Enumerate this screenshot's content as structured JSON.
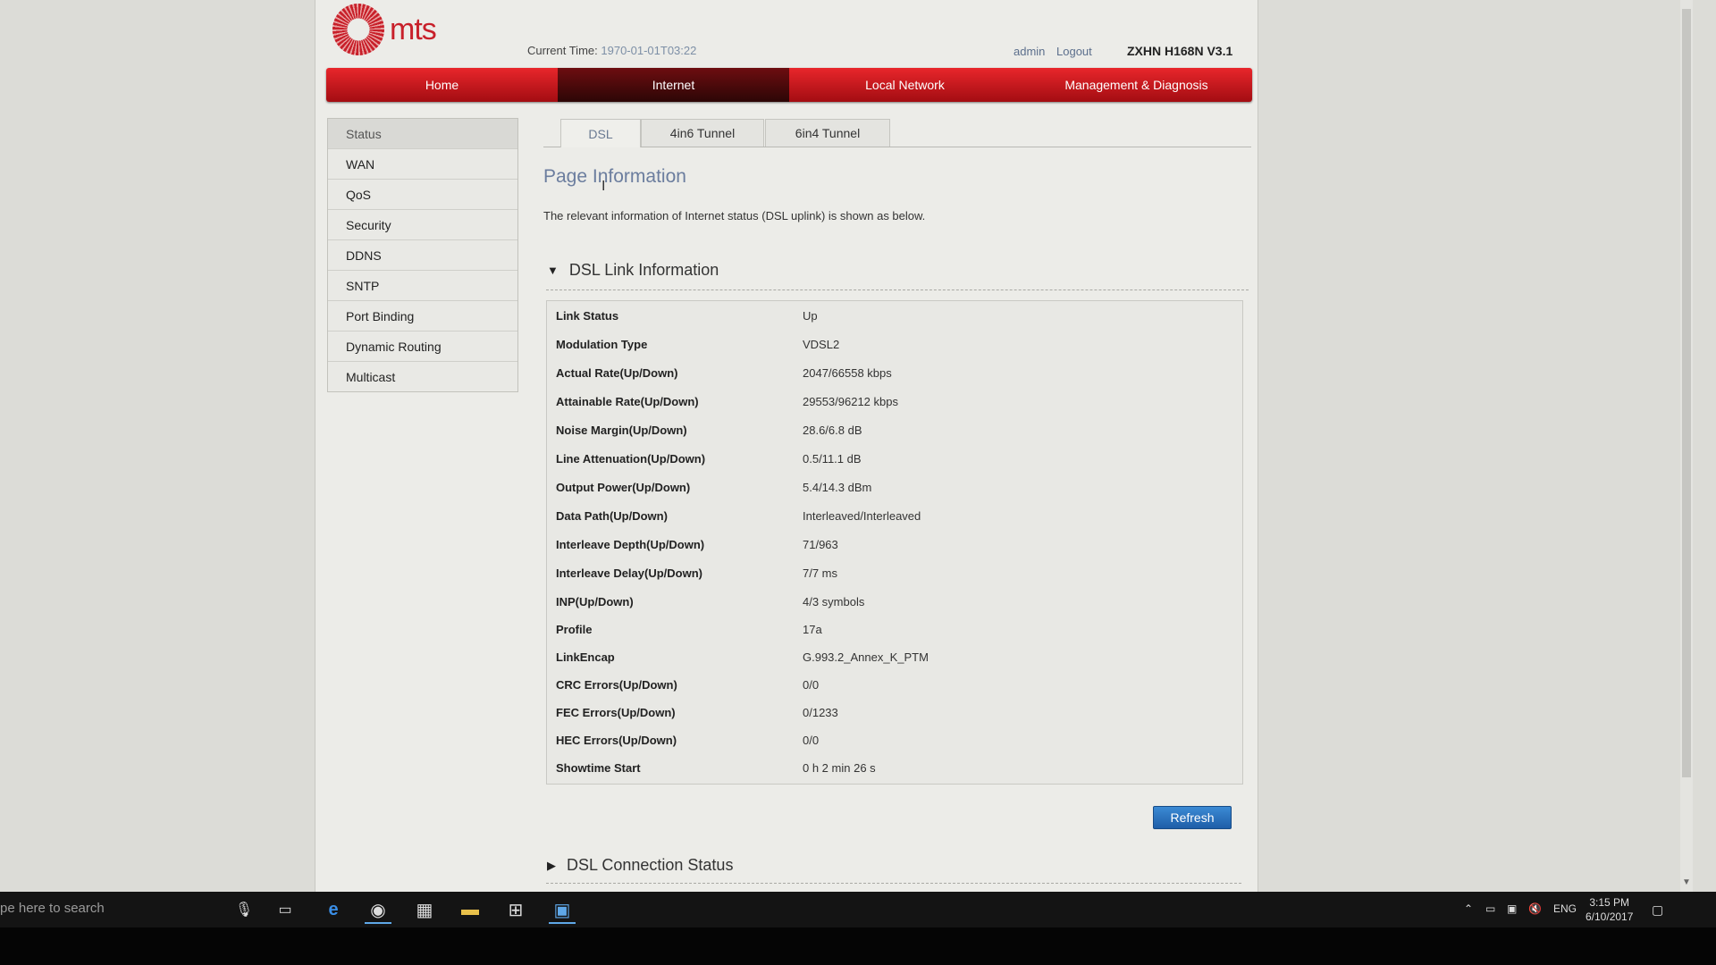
{
  "header": {
    "brand": "mts",
    "current_time_label": "Current Time:",
    "current_time_value": "1970-01-01T03:22",
    "user": "admin",
    "logout": "Logout",
    "model": "ZXHN H168N V3.1"
  },
  "nav": [
    {
      "label": "Home",
      "active": false
    },
    {
      "label": "Internet",
      "active": true
    },
    {
      "label": "Local Network",
      "active": false
    },
    {
      "label": "Management & Diagnosis",
      "active": false
    }
  ],
  "sidebar": [
    "Status",
    "WAN",
    "QoS",
    "Security",
    "DDNS",
    "SNTP",
    "Port Binding",
    "Dynamic Routing",
    "Multicast"
  ],
  "tabs": [
    {
      "label": "DSL",
      "active": true
    },
    {
      "label": "4in6 Tunnel",
      "active": false
    },
    {
      "label": "6in4 Tunnel",
      "active": false
    }
  ],
  "page": {
    "title": "Page Information",
    "description": "The relevant information of Internet status (DSL uplink) is shown as below."
  },
  "dsl_link": {
    "title": "DSL Link Information",
    "rows": [
      {
        "key": "Link Status",
        "value": "Up"
      },
      {
        "key": "Modulation Type",
        "value": "VDSL2"
      },
      {
        "key": "Actual Rate(Up/Down)",
        "value": "2047/66558 kbps"
      },
      {
        "key": "Attainable Rate(Up/Down)",
        "value": "29553/96212 kbps"
      },
      {
        "key": "Noise Margin(Up/Down)",
        "value": "28.6/6.8 dB"
      },
      {
        "key": "Line Attenuation(Up/Down)",
        "value": "0.5/11.1 dB"
      },
      {
        "key": "Output Power(Up/Down)",
        "value": "5.4/14.3 dBm"
      },
      {
        "key": "Data Path(Up/Down)",
        "value": "Interleaved/Interleaved"
      },
      {
        "key": "Interleave Depth(Up/Down)",
        "value": "71/963"
      },
      {
        "key": "Interleave Delay(Up/Down)",
        "value": "7/7 ms"
      },
      {
        "key": "INP(Up/Down)",
        "value": "4/3 symbols"
      },
      {
        "key": "Profile",
        "value": "17a"
      },
      {
        "key": "LinkEncap",
        "value": "G.993.2_Annex_K_PTM"
      },
      {
        "key": "CRC Errors(Up/Down)",
        "value": "0/0"
      },
      {
        "key": "FEC Errors(Up/Down)",
        "value": "0/1233"
      },
      {
        "key": "HEC Errors(Up/Down)",
        "value": "0/0"
      },
      {
        "key": "Showtime Start",
        "value": "0 h 2 min 26 s"
      }
    ]
  },
  "refresh_label": "Refresh",
  "dsl_connection": {
    "title": "DSL Connection Status"
  },
  "taskbar": {
    "search_text": "pe here to search",
    "lang": "ENG",
    "time": "3:15 PM",
    "date": "6/10/2017"
  },
  "colors": {
    "nav_red": "#c8202a",
    "refresh_blue": "#2a74c4",
    "title_blue": "#6b7d9e"
  }
}
